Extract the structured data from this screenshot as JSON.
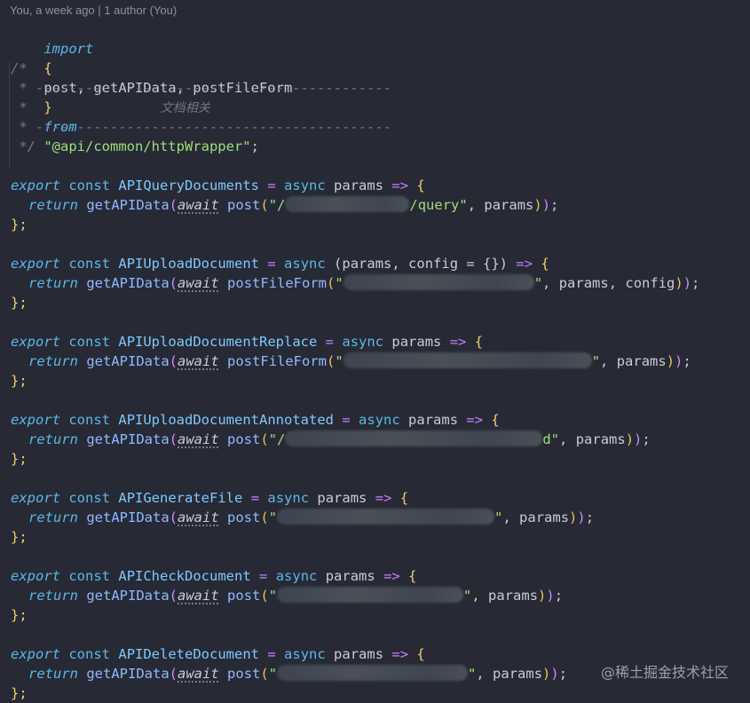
{
  "blame": "You, a week ago | 1 author (You)",
  "import_line": {
    "keyword": "import",
    "open": "{",
    "names": "post, getAPIData, postFileForm",
    "close": "}",
    "from": "from",
    "path": "\"@api/common/httpWrapper\"",
    "semi": ";"
  },
  "comment": {
    "open": "/*",
    "rule": " * -------------------------------------------",
    "title_star": " *",
    "title": "文档相关",
    "close": " */"
  },
  "functions": [
    {
      "name": "APIQueryDocuments",
      "params": "params",
      "call": "post",
      "url_tail": "/query\"",
      "url_head": "\"/",
      "args": ", params"
    },
    {
      "name": "APIUploadDocument",
      "params": "(params, config = {})",
      "call": "postFileForm",
      "url_tail": "\"",
      "url_head": "\"",
      "args": ", params, config"
    },
    {
      "name": "APIUploadDocumentReplace",
      "params": "params",
      "call": "postFileForm",
      "url_tail": "\"",
      "url_head": "\"",
      "args": ", params"
    },
    {
      "name": "APIUploadDocumentAnnotated",
      "params": "params",
      "call": "post",
      "url_tail": "d\"",
      "url_head": "\"/",
      "args": ", params"
    },
    {
      "name": "APIGenerateFile",
      "params": "params",
      "call": "post",
      "url_tail": "\"",
      "url_head": "\"",
      "args": ", params"
    },
    {
      "name": "APICheckDocument",
      "params": "params",
      "call": "post",
      "url_tail": "\"",
      "url_head": "\"",
      "args": ", params"
    },
    {
      "name": "APIDeleteDocument",
      "params": "params",
      "call": "post",
      "url_tail": "\"",
      "url_head": "\"",
      "args": ", params"
    }
  ],
  "tokens": {
    "export": "export",
    "const": "const",
    "eq": "=",
    "async": "async",
    "arrow": "=>",
    "open_brace": "{",
    "return": "return",
    "getAPIData": "getAPIData",
    "await": "await",
    "close": "};"
  },
  "watermark": "@稀土掘金技术社区"
}
